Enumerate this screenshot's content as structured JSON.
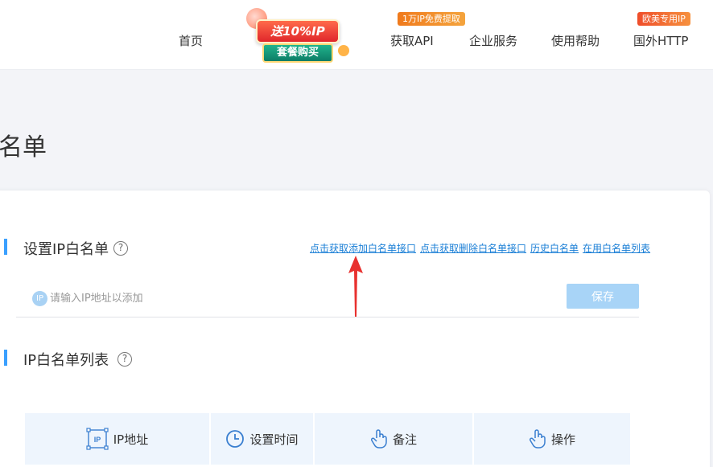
{
  "header": {
    "nav": {
      "home": "首页",
      "get_api": "获取API",
      "enterprise": "企业服务",
      "help": "使用帮助",
      "overseas": "国外HTTP"
    },
    "badges": {
      "get_api_badge": "1万IP免费提取",
      "overseas_badge": "欧美专用IP"
    },
    "promo": {
      "top_text": "送10%IP",
      "bottom_text": "套餐购买"
    }
  },
  "page": {
    "title": "名单"
  },
  "whitelist": {
    "section_title": "设置IP白名单",
    "help_glyph": "?",
    "links": [
      "点击获取添加白名单接口",
      "点击获取删除白名单接口",
      "历史白名单",
      "在用白名单列表"
    ],
    "ip_icon_text": "IP",
    "input_placeholder": "请输入IP地址以添加",
    "input_value": "",
    "save_label": "保存"
  },
  "list": {
    "section_title": "IP白名单列表",
    "help_glyph": "?",
    "columns": [
      {
        "label": "IP地址",
        "icon": "ip-box-icon"
      },
      {
        "label": "设置时间",
        "icon": "clock-icon"
      },
      {
        "label": "备注",
        "icon": "hand-pointer-icon"
      },
      {
        "label": "操作",
        "icon": "hand-pointer-icon"
      }
    ]
  },
  "colors": {
    "accent": "#3aa0ff",
    "link": "#1b7fd6",
    "save_button": "#a8d4f7",
    "table_header_bg": "#eef5fd",
    "arrow": "#e8312f"
  }
}
